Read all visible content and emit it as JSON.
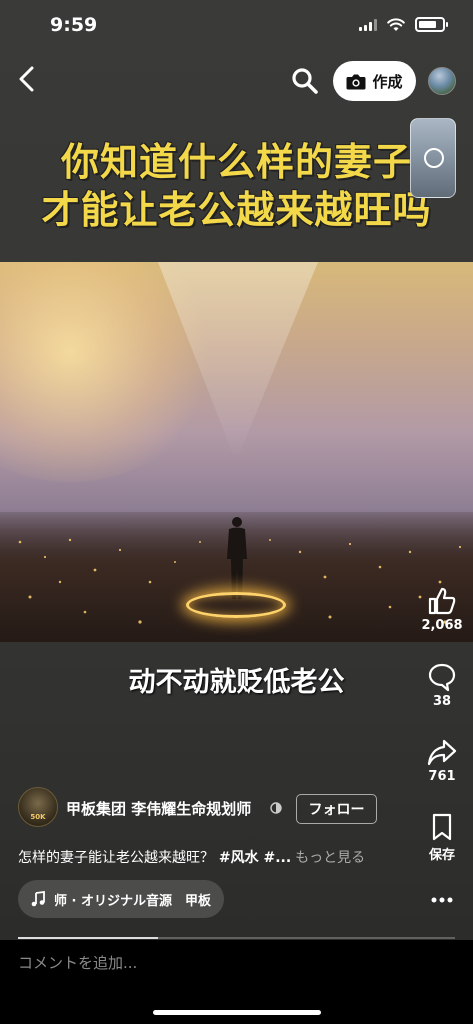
{
  "status_bar": {
    "time": "9:59",
    "battery_level": 0.75
  },
  "nav": {
    "create_label": "作成"
  },
  "video": {
    "headline_line1": "你知道什么样的妻子",
    "headline_line2": "才能让老公越来越旺吗",
    "subtitle": "动不动就贬低老公",
    "progress": 0.32
  },
  "actions": {
    "likes": "2,068",
    "comments": "38",
    "shares": "761",
    "save_label": "保存"
  },
  "author": {
    "name": "甲板集团 李伟耀生命规划师",
    "avatar_badge": "50K",
    "follow_label": "フォロー"
  },
  "caption": {
    "text": "怎样的妻子能让老公越来越旺？",
    "tags": " #风水 #...",
    "more_label": "もっと見る"
  },
  "music": {
    "label": "师 · オリジナル音源　甲板"
  },
  "comment": {
    "placeholder": "コメントを追加..."
  }
}
